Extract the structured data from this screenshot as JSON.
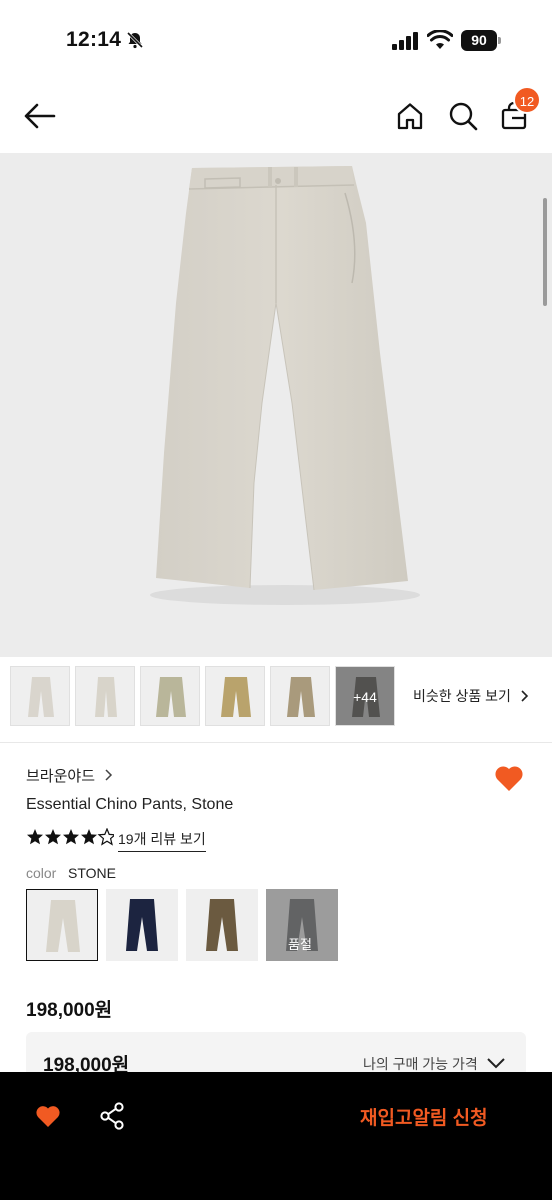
{
  "status_bar": {
    "time": "12:14",
    "battery": "90",
    "icons": [
      "bell-off-icon",
      "signal-icon",
      "wifi-icon",
      "battery-icon"
    ]
  },
  "header": {
    "icons": [
      "back-arrow-icon",
      "home-icon",
      "search-icon",
      "shopping-bag-icon"
    ],
    "cart_count": "12"
  },
  "gallery": {
    "thumbnails": [
      {
        "color": "#d9d5cd"
      },
      {
        "color": "#d8d4ca"
      },
      {
        "color": "#b9b69a"
      },
      {
        "color": "#b9a36c"
      },
      {
        "color": "#a99a7c"
      },
      {
        "color": "#3f3b33",
        "more_label": "+44"
      }
    ],
    "similar_link": "비슷한 상품 보기"
  },
  "product": {
    "brand": "브라운야드",
    "name": "Essential Chino Pants, Stone",
    "rating": 4.5,
    "review_link": "19개 리뷰 보기",
    "color_label": "color",
    "selected_color": "STONE",
    "colors": [
      {
        "color": "#d8d4ca",
        "selected": true
      },
      {
        "color": "#1c2440",
        "selected": false
      },
      {
        "color": "#6b5a40",
        "selected": false
      },
      {
        "color": "#4a4d52",
        "selected": false,
        "soldout_label": "품절"
      }
    ],
    "price": "198,000원",
    "my_price_amount": "198,000원",
    "my_price_label": "나의 구매 가능 가격"
  },
  "bottom_bar": {
    "restock_label": "재입고알림 신청",
    "icons": [
      "heart-icon",
      "share-icon"
    ]
  },
  "colors": {
    "accent": "#f15a22",
    "bottom_bar": "#000000"
  }
}
